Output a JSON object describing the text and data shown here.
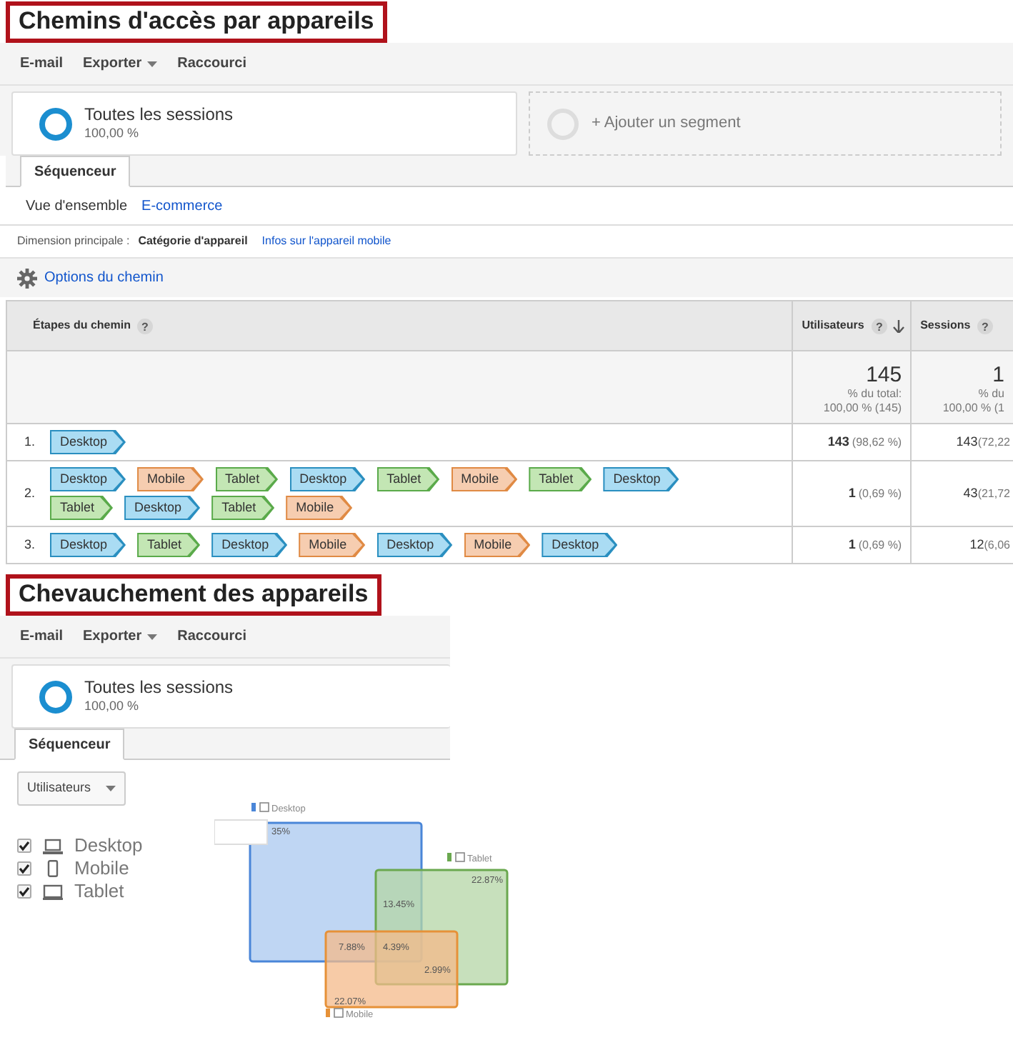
{
  "paths_report": {
    "title": "Chemins d'accès par appareils",
    "toolbar": [
      {
        "label": "E-mail",
        "dropdown": false
      },
      {
        "label": "Exporter",
        "dropdown": true
      },
      {
        "label": "Raccourci",
        "dropdown": false
      }
    ],
    "segments": [
      {
        "kind": "active",
        "label": "Toutes les sessions",
        "sub": "100,00 %"
      },
      {
        "kind": "add",
        "label": "+ Ajouter un segment"
      }
    ],
    "tabs": [
      {
        "label": "Séquenceur",
        "selected": true
      }
    ],
    "subtabs": [
      {
        "label": "Vue d'ensemble",
        "selected": true
      },
      {
        "label": "E-commerce",
        "selected": false
      }
    ],
    "dimension": {
      "label": "Dimension principale :",
      "value": "Catégorie d'appareil",
      "link": "Infos sur l'appareil mobile"
    },
    "options_link": "Options du chemin",
    "table": {
      "columns": [
        {
          "label": "Étapes du chemin",
          "help": "?",
          "sorted": false
        },
        {
          "label": "Utilisateurs",
          "help": "?",
          "sorted": true
        },
        {
          "label": "Sessions",
          "help": "?",
          "sorted": false
        }
      ],
      "totals": [
        {
          "value": "145",
          "label": "% du total:",
          "sub": "100,00 % (145)"
        },
        {
          "value": "1",
          "label": "% du",
          "sub": "100,00 % (1"
        }
      ],
      "rows": [
        {
          "index": "1.",
          "steps": [
            {
              "kind": "desktop",
              "label": "Desktop"
            }
          ],
          "users": "143",
          "users_pct": "(98,62 %)",
          "sessions": "143",
          "sessions_pct": "(72,22"
        },
        {
          "index": "2.",
          "steps": [
            {
              "kind": "desktop",
              "label": "Desktop"
            },
            {
              "kind": "mobile",
              "label": "Mobile"
            },
            {
              "kind": "tablet",
              "label": "Tablet"
            },
            {
              "kind": "desktop",
              "label": "Desktop"
            },
            {
              "kind": "tablet",
              "label": "Tablet"
            },
            {
              "kind": "mobile",
              "label": "Mobile"
            },
            {
              "kind": "tablet",
              "label": "Tablet"
            },
            {
              "kind": "desktop",
              "label": "Desktop"
            },
            {
              "kind": "tablet",
              "label": "Tablet"
            },
            {
              "kind": "desktop",
              "label": "Desktop"
            },
            {
              "kind": "tablet",
              "label": "Tablet"
            },
            {
              "kind": "mobile",
              "label": "Mobile"
            }
          ],
          "users": "1",
          "users_pct": "(0,69 %)",
          "sessions": "43",
          "sessions_pct": "(21,72"
        },
        {
          "index": "3.",
          "steps": [
            {
              "kind": "desktop",
              "label": "Desktop"
            },
            {
              "kind": "tablet",
              "label": "Tablet"
            },
            {
              "kind": "desktop",
              "label": "Desktop"
            },
            {
              "kind": "mobile",
              "label": "Mobile"
            },
            {
              "kind": "desktop",
              "label": "Desktop"
            },
            {
              "kind": "mobile",
              "label": "Mobile"
            },
            {
              "kind": "desktop",
              "label": "Desktop"
            }
          ],
          "users": "1",
          "users_pct": "(0,69 %)",
          "sessions": "12",
          "sessions_pct": "(6,06"
        }
      ]
    }
  },
  "overlap_report": {
    "title": "Chevauchement des appareils",
    "toolbar": [
      {
        "label": "E-mail",
        "dropdown": false
      },
      {
        "label": "Exporter",
        "dropdown": true
      },
      {
        "label": "Raccourci",
        "dropdown": false
      }
    ],
    "segment": {
      "label": "Toutes les sessions",
      "sub": "100,00 %"
    },
    "tabs": [
      {
        "label": "Séquenceur",
        "selected": true
      }
    ],
    "metric_dropdown": "Utilisateurs",
    "devices": [
      {
        "kind": "desktop",
        "label": "Desktop",
        "checked": true
      },
      {
        "kind": "mobile",
        "label": "Mobile",
        "checked": true
      },
      {
        "kind": "tablet",
        "label": "Tablet",
        "checked": true
      }
    ],
    "venn": {
      "sets": [
        {
          "kind": "desktop",
          "label": "Desktop",
          "color": "#4a86d8"
        },
        {
          "kind": "tablet",
          "label": "Tablet",
          "color": "#6aa84f"
        },
        {
          "kind": "mobile",
          "label": "Mobile",
          "color": "#e69138"
        }
      ],
      "regions": [
        {
          "kind": "desktop",
          "value": "35%"
        },
        {
          "kind": "tablet",
          "value": "22.87%"
        },
        {
          "kind": "desktop_tablet",
          "value": "13.45%"
        },
        {
          "kind": "desktop_mobile",
          "value": "7.88%"
        },
        {
          "kind": "all",
          "value": "4.39%"
        },
        {
          "kind": "tablet_mobile",
          "value": "2.99%"
        },
        {
          "kind": "mobile",
          "value": "22.07%"
        }
      ]
    }
  }
}
